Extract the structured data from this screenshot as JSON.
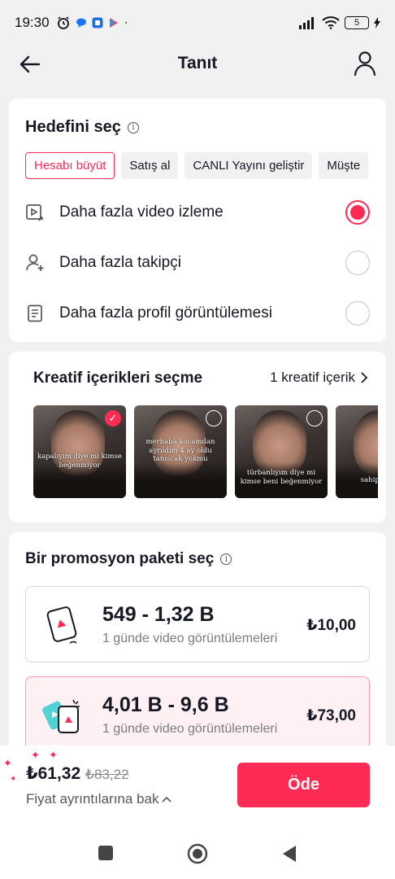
{
  "status_bar": {
    "time": "19:30",
    "battery": "5"
  },
  "header": {
    "title": "Tanıt"
  },
  "goal_section": {
    "title": "Hedefini seç",
    "chips": [
      "Hesabı büyüt",
      "Satış al",
      "CANLI Yayını geliştir",
      "Müşte"
    ],
    "options": [
      {
        "label": "Daha fazla video izleme",
        "icon": "video-view-icon",
        "selected": true
      },
      {
        "label": "Daha fazla takipçi",
        "icon": "add-follower-icon",
        "selected": false
      },
      {
        "label": "Daha fazla profil görüntülemesi",
        "icon": "profile-page-icon",
        "selected": false
      }
    ]
  },
  "creative_section": {
    "title": "Kreatif içerikleri seçme",
    "count_label": "1 kreatif içerik",
    "thumbnails": [
      {
        "caption": "kapalıyım diye mi kimse beğenmiyor",
        "selected": true
      },
      {
        "caption": "merhaba kocamdan ayrıldım 4 ay oldu tanıscak yokmu",
        "selected": false
      },
      {
        "caption": "türbanlıyım diye mi kimse beni beğenmiyor",
        "selected": false
      },
      {
        "caption": "merhaba sahiplence etsin m",
        "selected": false
      }
    ]
  },
  "package_section": {
    "title": "Bir promosyon paketi seç",
    "packages": [
      {
        "range": "549 - 1,32 B",
        "subtitle": "1 günde video görüntülemeleri",
        "price": "₺10,00",
        "selected": false
      },
      {
        "range": "4,01 B - 9,6 B",
        "subtitle": "1 günde video görüntülemeleri",
        "price": "₺73,00",
        "selected": true
      }
    ]
  },
  "checkout": {
    "price_now": "₺61,32",
    "price_old": "₺83,22",
    "details_label": "Fiyat ayrıntılarına bak",
    "pay_label": "Öde"
  },
  "colors": {
    "accent": "#fe2c55",
    "selected_package_bg": "#fff1f3"
  }
}
